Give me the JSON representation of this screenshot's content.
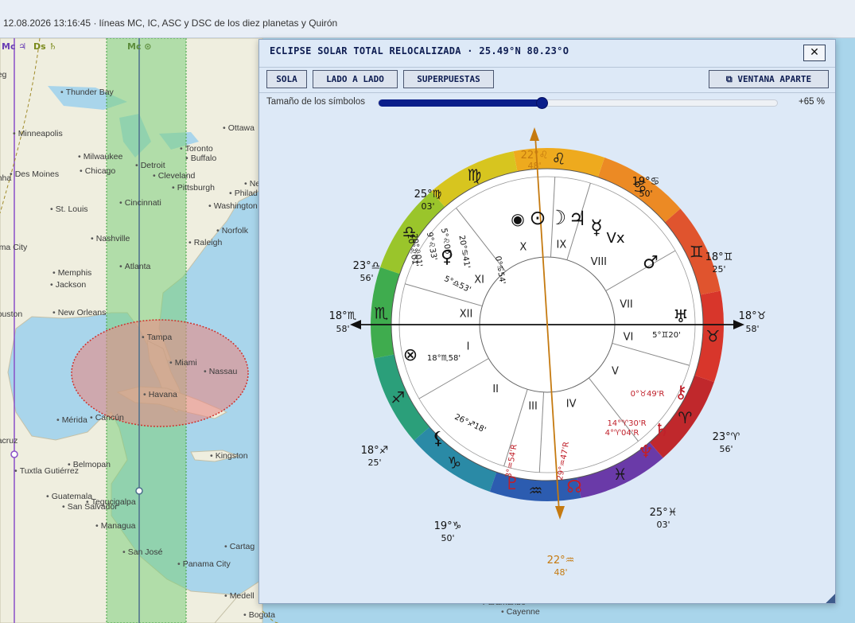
{
  "topbar": {
    "title": "12.08.2026 13:16:45 · líneas MC, IC, ASC y DSC de los diez planetas y Quirón"
  },
  "map": {
    "line_labels": [
      {
        "text": "Mc ♃",
        "color": "#6a3fb5"
      },
      {
        "text": "Ds ♄",
        "color": "#7a8a1a"
      },
      {
        "text": "Mc ⊙",
        "color": "#5c8d3c"
      }
    ],
    "cities": [
      "Thunder Bay",
      "Minneapolis",
      "Ottawa",
      "Toronto",
      "Milwaukee",
      "Detroit",
      "Buffalo",
      "Des Moines",
      "Chicago",
      "Cleveland",
      "Pittsburgh",
      "Philad",
      "Ne",
      "St. Louis",
      "Cincinnati",
      "Washington",
      "Norfolk",
      "Nashville",
      "Raleigh",
      "Memphis",
      "Atlanta",
      "Jackson",
      "New Orleans",
      "Tampa",
      "Miami",
      "Nassau",
      "Havana",
      "Mérida",
      "Cancún",
      "Belmopan",
      "Kingston",
      "Tuxtla Gutiérrez",
      "Guatemala",
      "Tegucigalpa",
      "San Salvador",
      "Managua",
      "San José",
      "Panama City",
      "Cartag",
      "Medell",
      "Bogota",
      "Cayenne",
      "Paramaribo",
      "ma City",
      "ouston",
      "hha",
      "eg",
      "acruz"
    ]
  },
  "dialog": {
    "title": "ECLIPSE SOLAR TOTAL RELOCALIZADA · 25.49°N 80.23°O",
    "close_label": "✕",
    "buttons": {
      "sola": "SOLA",
      "lado": "LADO A LADO",
      "superpuestas": "SUPERPUESTAS",
      "ventana": "⧉ VENTANA APARTE"
    },
    "slider": {
      "label": "Tamaño de los símbolos",
      "value_percent": 65,
      "value_text": "+65 %"
    }
  },
  "wheel": {
    "mc": {
      "deg": "22°♌",
      "min": "48'"
    },
    "ic": {
      "deg": "22°♒",
      "min": "48'"
    },
    "asc": {
      "deg": "18°♏",
      "min": "58'"
    },
    "dsc": {
      "deg": "18°♉",
      "min": "58'"
    },
    "house_numbers": [
      "I",
      "II",
      "III",
      "IV",
      "V",
      "VI",
      "VII",
      "VIII",
      "IX",
      "X",
      "XI",
      "XII"
    ],
    "cusps": [
      {
        "deg": "25°♍",
        "min": "03'"
      },
      {
        "deg": "19°♋",
        "min": "50'"
      },
      {
        "deg": "18°♊",
        "min": "25'"
      },
      {
        "deg": "23°♎",
        "min": "56'"
      },
      {
        "deg": "23°♈",
        "min": "56'"
      },
      {
        "deg": "18°♐",
        "min": "25'"
      },
      {
        "deg": "25°♓",
        "min": "03'"
      },
      {
        "deg": "19°♑",
        "min": "50'"
      }
    ],
    "planets": [
      {
        "glyph": "⊙",
        "label": "20°♌01'"
      },
      {
        "glyph": "☽",
        "label": "20°♌01'"
      },
      {
        "glyph": "♃",
        "label": "9°♌33'"
      },
      {
        "glyph": "☿",
        "label": "5°♌06'"
      },
      {
        "glyph": "Vx",
        "label": "20°♋41'"
      },
      {
        "glyph": "♂",
        "label": "0°♋54'"
      },
      {
        "glyph": "♅",
        "label": "5°♊20'"
      },
      {
        "glyph": "⚷",
        "label": "0°♉49'R"
      },
      {
        "glyph": "♄",
        "label": "14°♈30'R"
      },
      {
        "glyph": "♆",
        "label": "4°♈04'R"
      },
      {
        "glyph": "☊",
        "label": "29°♒47'R"
      },
      {
        "glyph": "♇",
        "label": "3°♒54'R"
      },
      {
        "glyph": "⚸",
        "label": "26°♐18'"
      },
      {
        "glyph": "⊗",
        "label": "18°♏58'"
      },
      {
        "glyph": "♀",
        "label": "5°♎53'"
      },
      {
        "glyph": "◉",
        "label": ""
      }
    ],
    "signs": [
      "♈",
      "♉",
      "♊",
      "♋",
      "♌",
      "♍",
      "♎",
      "♏",
      "♐",
      "♑",
      "♒",
      "♓"
    ],
    "colors": {
      "aries": "#c0282c",
      "taurus": "#d8362b",
      "gemini": "#e0542e",
      "cancer": "#ec8a24",
      "leo": "#eeaa1e",
      "virgo": "#d7c51f",
      "libra": "#9ac52b",
      "scorpio": "#3fac4e",
      "sagittarius": "#2b9f7a",
      "capricorn": "#2a8aa6",
      "aquarius": "#2c5cb0",
      "pisces": "#6a3aa8",
      "axis_mc": "#c57a10",
      "retro": "#c0202a"
    }
  }
}
